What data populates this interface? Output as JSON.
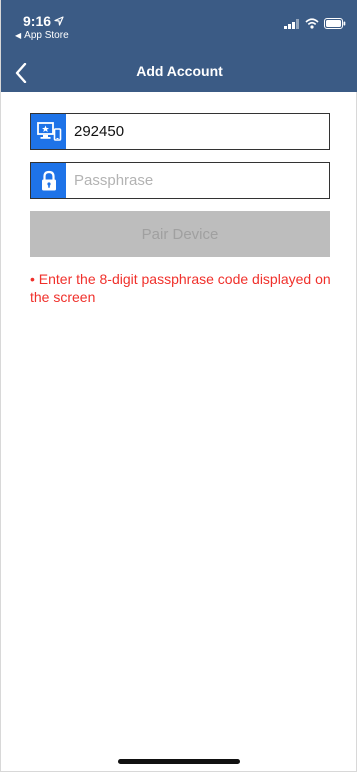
{
  "status_bar": {
    "time": "9:16",
    "back_app": "App Store"
  },
  "nav": {
    "title": "Add Account"
  },
  "form": {
    "device_id_value": "292450",
    "passphrase_placeholder": "Passphrase",
    "pair_button_label": "Pair Device",
    "hint": "• Enter the 8-digit passphrase code displayed on the screen"
  },
  "colors": {
    "header": "#3b5b85",
    "icon_background": "#1e73e8",
    "hint_text": "#f0302b",
    "button_disabled": "#bdbdbd"
  }
}
